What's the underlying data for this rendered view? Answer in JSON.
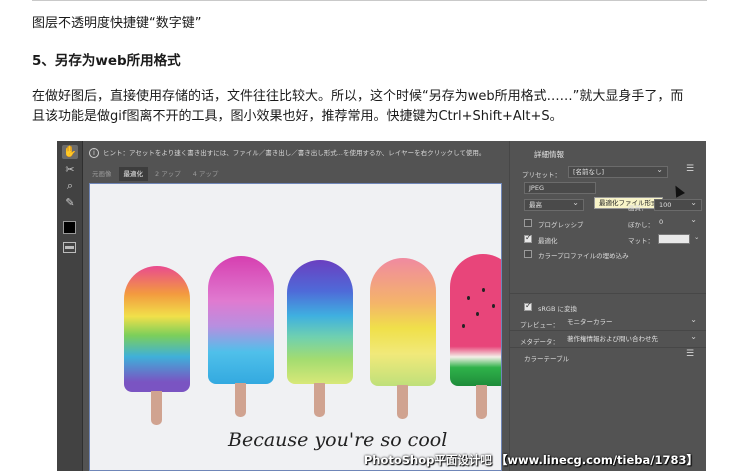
{
  "article": {
    "line1": "图层不透明度快捷键“数字键”",
    "heading": "5、另存为web所用格式",
    "body_line1": "在做好图后，直接使用存储的话，文件往往比较大。所以，这个时候“另存为web所用格式……”就大显身手了，而",
    "body_line2": "且该功能是做gif图离不开的工具，图小效果也好，推荐常用。快捷键为Ctrl+Shift+Alt+S。"
  },
  "photoshop": {
    "hint": "ヒント：アセットをより速く書き出すには、ファイル／書き出し／書き出し形式...を使用するか、レイヤーを右クリックして使用。",
    "tabs": [
      "元画像",
      "最適化",
      "2 アップ",
      "4 アップ"
    ],
    "active_tab": "最適化",
    "canvas_text": "Because you're so cool",
    "panel": {
      "title": "詳細情報",
      "preset_label": "プリセット：",
      "preset_value": "[名前なし]",
      "format_value": "JPEG",
      "tooltip": "最適化ファイル形式",
      "quality_partial": "最高",
      "quality_label": "画質：",
      "quality_value": "100",
      "progressive": "プログレッシブ",
      "blur_label": "ぼかし：",
      "blur_value": "0",
      "optimized": "最適化",
      "matte_label": "マット：",
      "embed_profile": "カラープロファイルの埋め込み",
      "srgb": "sRGB に変換",
      "preview_label": "プレビュー：",
      "preview_value": "モニターカラー",
      "metadata_label": "メタデータ：",
      "metadata_value": "著作権情報および問い合わせ先",
      "color_table": "カラーテーブル"
    }
  },
  "watermark": "PhotoShop平面设计吧 【www.linecg.com/tieba/1783】"
}
